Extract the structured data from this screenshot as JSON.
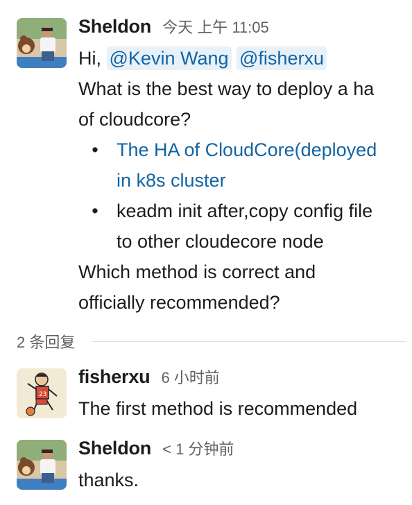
{
  "messages": [
    {
      "author": "Sheldon",
      "time": "今天 上午 11:05",
      "greeting": "Hi,",
      "mentions": [
        "@Kevin Wang",
        "@fisherxu"
      ],
      "question_lines": [
        "What is the best way to deploy a ha",
        "of cloudcore?"
      ],
      "bullets": [
        {
          "lines": [
            "The HA of CloudCore(deployed",
            "in k8s cluster"
          ],
          "is_link": true
        },
        {
          "lines": [
            "keadm init after,copy config file",
            "to other cloudecore node"
          ],
          "is_link": false
        }
      ],
      "closing_lines": [
        "Which method is correct and",
        "officially recommended?"
      ]
    },
    {
      "author": "fisherxu",
      "time": "6 小时前",
      "text": "The first method is recommended"
    },
    {
      "author": "Sheldon",
      "time": "< 1 分钟前",
      "text": "thanks."
    }
  ],
  "replies": {
    "label": "2 条回复"
  },
  "colors": {
    "link": "#1264a3",
    "mention_bg": "#e8f1f8",
    "muted": "#616061"
  },
  "icons": {
    "bullet": "•"
  }
}
